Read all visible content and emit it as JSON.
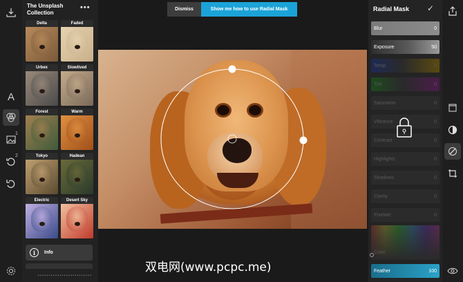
{
  "filters_panel": {
    "title": "The Unsplash Collection",
    "more_label": "•••",
    "thumbnails": [
      {
        "name": "Delta"
      },
      {
        "name": "Faded"
      },
      {
        "name": "Urbex"
      },
      {
        "name": "Slowlived"
      },
      {
        "name": "Forest"
      },
      {
        "name": "Warm"
      },
      {
        "name": "Tokyo"
      },
      {
        "name": "Hadean"
      },
      {
        "name": "Electric"
      },
      {
        "name": "Desert Sky"
      }
    ],
    "info_label": "Info",
    "info_icon": "i"
  },
  "left_toolbar": {
    "icons": [
      "download-icon",
      "text-icon",
      "filters-icon",
      "image-icon",
      "history-icon",
      "undo-icon",
      "settings-icon"
    ],
    "text_glyph": "A",
    "image_badge": "1",
    "history_badge": "2"
  },
  "banner": {
    "dismiss_label": "Dismiss",
    "help_label": "Show me how to use Radial Mask",
    "accent": "#1ba3d8"
  },
  "adjust_panel": {
    "title": "Radial Mask",
    "confirm_icon": "check-icon",
    "sliders": [
      {
        "name": "Blur",
        "value": "0"
      },
      {
        "name": "Exposure",
        "value": "50"
      },
      {
        "name": "Temp",
        "value": "0"
      },
      {
        "name": "Tint",
        "value": "0"
      },
      {
        "name": "Saturation",
        "value": "0"
      },
      {
        "name": "Vibrance",
        "value": "0"
      },
      {
        "name": "Contrast",
        "value": "0"
      },
      {
        "name": "Highlights",
        "value": "0"
      },
      {
        "name": "Shadows",
        "value": "0"
      },
      {
        "name": "Clarity",
        "value": "0"
      },
      {
        "name": "Pixelate",
        "value": "0"
      },
      {
        "name": "Color",
        "value": ""
      },
      {
        "name": "Feather",
        "value": "100"
      }
    ]
  },
  "right_toolbar": {
    "icons": [
      "share-icon",
      "crop-frame-icon",
      "radial-mask-icon",
      "brush-icon",
      "crop-icon",
      "eye-icon"
    ]
  },
  "watermark": "双电网(www.pcpc.me)"
}
